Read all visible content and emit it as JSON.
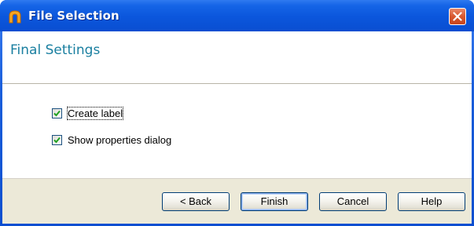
{
  "window": {
    "title": "File Selection",
    "app_icon": "orange-arch-icon",
    "close_icon": "close-icon",
    "close_color": "#d8582f"
  },
  "header": {
    "title": "Final Settings",
    "title_color": "#1a7fa0"
  },
  "options": [
    {
      "label": "Create label",
      "checked": true
    },
    {
      "label": "Show properties dialog",
      "checked": true
    }
  ],
  "buttons": {
    "back": "< Back",
    "finish": "Finish",
    "cancel": "Cancel",
    "help": "Help"
  }
}
